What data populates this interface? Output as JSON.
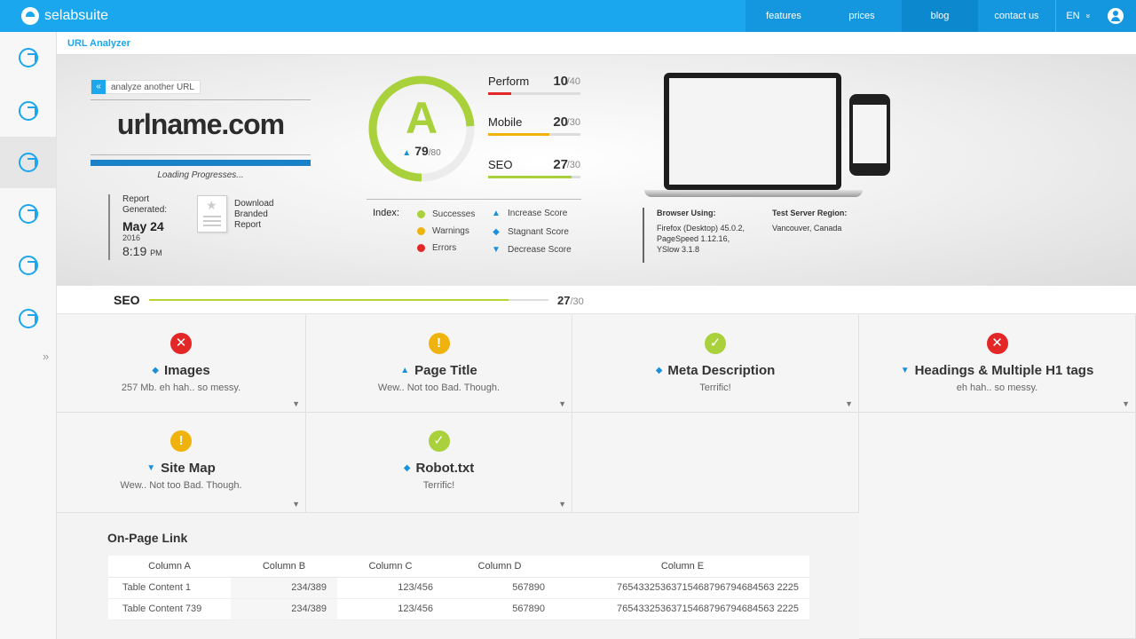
{
  "brand": {
    "name": "selabsuite"
  },
  "nav": {
    "items": [
      "features",
      "prices",
      "blog",
      "contact us"
    ],
    "lang": "EN",
    "lang_caret": "»"
  },
  "breadcrumb": "URL Analyzer",
  "hero": {
    "analyze_button": "analyze another URL",
    "url": "urlname.com",
    "loading_progress": 1.0,
    "loading_text": "Loading Progresses...",
    "report_generated": "Report Generated:",
    "report_date": "May 24",
    "report_year": "2016",
    "report_time": "8:19",
    "report_ampm": "PM",
    "download_label": "Download Branded Report",
    "grade": "A",
    "score": "79",
    "score_max": "/80",
    "metrics": [
      {
        "name": "Perform",
        "value": "10",
        "max": "/40",
        "color": "#e32626"
      },
      {
        "name": "Mobile",
        "value": "20",
        "max": "/30",
        "color": "#f0b30e"
      },
      {
        "name": "SEO",
        "value": "27",
        "max": "/30",
        "color": "#a9d13b"
      }
    ],
    "index_label": "Index:",
    "index_status": [
      {
        "label": "Successes",
        "color": "#a9d13b"
      },
      {
        "label": "Warnings",
        "color": "#f0b30e"
      },
      {
        "label": "Errors",
        "color": "#e32626"
      }
    ],
    "index_trend": [
      {
        "label": "Increase Score",
        "icon": "arrow-up-icon"
      },
      {
        "label": "Stagnant Score",
        "icon": "stagnant-icon"
      },
      {
        "label": "Decrease Score",
        "icon": "arrow-down-icon"
      }
    ],
    "browser_label": "Browser Using:",
    "browser_value": "Firefox (Desktop) 45.0.2, PageSpeed 1.12.16, YSlow 3.1.8",
    "region_label": "Test Server Region:",
    "region_value": "Vancouver, Canada"
  },
  "seo_bar": {
    "label": "SEO",
    "value": "27",
    "max": "/30",
    "progress": 0.9
  },
  "checks": [
    {
      "title": "Images",
      "subtitle": "257 Mb. eh hah.. so messy.",
      "status": "error",
      "trend": "stagnant"
    },
    {
      "title": "Page Title",
      "subtitle": "Wew.. Not too Bad. Though.",
      "status": "warning",
      "trend": "increase"
    },
    {
      "title": "Meta Description",
      "subtitle": "Terrific!",
      "status": "success",
      "trend": "stagnant"
    },
    {
      "title": "Headings & Multiple H1 tags",
      "subtitle": "eh hah.. so messy.",
      "status": "error",
      "trend": "decrease"
    },
    {
      "title": "Site Map",
      "subtitle": "Wew.. Not too Bad. Though.",
      "status": "warning",
      "trend": "decrease"
    },
    {
      "title": "Robot.txt",
      "subtitle": "Terrific!",
      "status": "success",
      "trend": "stagnant"
    }
  ],
  "onpage": {
    "title": "On-Page Link",
    "columns": [
      "Column A",
      "Column B",
      "Column C",
      "Column D",
      "Column E"
    ],
    "rows": [
      [
        "Table Content 1",
        "234/389",
        "123/456",
        "567890",
        "76543325363715468796794684563 2225"
      ],
      [
        "Table Content 739",
        "234/389",
        "123/456",
        "567890",
        "76543325363715468796794684563 2225"
      ]
    ]
  },
  "colors": {
    "accent": "#1aa7ee",
    "success": "#a9d13b",
    "warning": "#f0b30e",
    "error": "#e32626",
    "trend": "#1a90d8"
  }
}
